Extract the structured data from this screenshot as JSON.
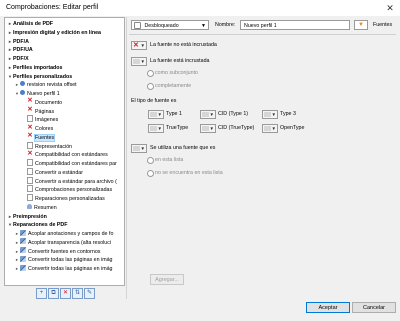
{
  "window": {
    "title": "Comprobaciones: Editar perfil",
    "close_label": "✕"
  },
  "tree": [
    {
      "label": "Análisis de PDF",
      "bold": true,
      "level": 0,
      "toggle": "▸",
      "icon": ""
    },
    {
      "label": "Impresión digital y edición en línea",
      "bold": true,
      "level": 0,
      "toggle": "▸",
      "icon": ""
    },
    {
      "label": "PDF/A",
      "bold": true,
      "level": 0,
      "toggle": "▸",
      "icon": ""
    },
    {
      "label": "PDF/UA",
      "bold": true,
      "level": 0,
      "toggle": "▸",
      "icon": ""
    },
    {
      "label": "PDF/X",
      "bold": true,
      "level": 0,
      "toggle": "▸",
      "icon": ""
    },
    {
      "label": "Perfiles importados",
      "bold": true,
      "level": 0,
      "toggle": "▸",
      "icon": ""
    },
    {
      "label": "Perfiles personalizados",
      "bold": true,
      "level": 0,
      "toggle": "▾",
      "icon": ""
    },
    {
      "label": "revision revista offset",
      "bold": false,
      "level": 1,
      "toggle": "▸",
      "icon": "search-icon"
    },
    {
      "label": "Nuevo perfil 1",
      "bold": false,
      "level": 1,
      "toggle": "▾",
      "icon": "search-icon"
    },
    {
      "label": "Documento",
      "bold": false,
      "level": 2,
      "toggle": "",
      "icon": "redx"
    },
    {
      "label": "Páginas",
      "bold": false,
      "level": 2,
      "toggle": "",
      "icon": "redx"
    },
    {
      "label": "Imágenes",
      "bold": false,
      "level": 2,
      "toggle": "",
      "icon": "page"
    },
    {
      "label": "Colores",
      "bold": false,
      "level": 2,
      "toggle": "",
      "icon": "redx"
    },
    {
      "label": "Fuentes",
      "bold": false,
      "level": 2,
      "toggle": "",
      "icon": "redx",
      "selected": true
    },
    {
      "label": "Representación",
      "bold": false,
      "level": 2,
      "toggle": "",
      "icon": "page"
    },
    {
      "label": "Compatibilidad con estándares",
      "bold": false,
      "level": 2,
      "toggle": "",
      "icon": "redx"
    },
    {
      "label": "Compatibilidad con estándares par",
      "bold": false,
      "level": 2,
      "toggle": "",
      "icon": "page"
    },
    {
      "label": "Convertir a estándar",
      "bold": false,
      "level": 2,
      "toggle": "",
      "icon": "page"
    },
    {
      "label": "Convertir a estándar para archivo (",
      "bold": false,
      "level": 2,
      "toggle": "",
      "icon": "page"
    },
    {
      "label": "Comprobaciones personalizadas",
      "bold": false,
      "level": 2,
      "toggle": "",
      "icon": "page"
    },
    {
      "label": "Reparaciones personalizadas",
      "bold": false,
      "level": 2,
      "toggle": "",
      "icon": "page"
    },
    {
      "label": "Resumen",
      "bold": false,
      "level": 2,
      "toggle": "",
      "icon": "person"
    },
    {
      "label": "Preimpresión",
      "bold": true,
      "level": 0,
      "toggle": "▸",
      "icon": ""
    },
    {
      "label": "Reparaciones de PDF",
      "bold": true,
      "level": 0,
      "toggle": "▾",
      "icon": ""
    },
    {
      "label": "Acoplar anotaciones y campos de fo",
      "bold": false,
      "level": 1,
      "toggle": "▸",
      "icon": "wrench"
    },
    {
      "label": "Acoplar transparencia (alta resoluci",
      "bold": false,
      "level": 1,
      "toggle": "▸",
      "icon": "wrench"
    },
    {
      "label": "Convertir fuentes en contornos",
      "bold": false,
      "level": 1,
      "toggle": "▸",
      "icon": "wrench"
    },
    {
      "label": "Convertir todas las páginas en imág",
      "bold": false,
      "level": 1,
      "toggle": "▸",
      "icon": "wrench"
    },
    {
      "label": "Convertir todas las páginas en imág",
      "bold": false,
      "level": 1,
      "toggle": "▸",
      "icon": "wrench"
    }
  ],
  "tree_buttons": [
    "+",
    "⧉",
    "✕",
    "⇅",
    "✎"
  ],
  "toolbar": {
    "lock_value": "Desbloqueado",
    "name_label": "Nombre:",
    "name_value": "Nuevo perfil 1",
    "fonts_label": "Fuentes"
  },
  "panel": {
    "not_embedded_label": "La fuente no está incrustada",
    "embedded_label": "La fuente está incrustada",
    "embedded_opts": [
      "como subconjunto",
      "completamente"
    ],
    "font_type_heading": "El tipo de fuente es",
    "font_types": [
      "Type 1",
      "CID (Type 1)",
      "Type 3",
      "TrueType",
      "CID (TrueType)",
      "OpenType"
    ],
    "used_label": "Se utiliza una fuente que es",
    "used_opts": [
      "en esta lista",
      "no se encuentra en esta lista"
    ],
    "add_button": "Agregar..."
  },
  "footer": {
    "ok": "Aceptar",
    "cancel": "Cancelar"
  },
  "colors": {
    "red": "#d0161d",
    "accent": "#0078d7",
    "orange": "#f0851c"
  }
}
